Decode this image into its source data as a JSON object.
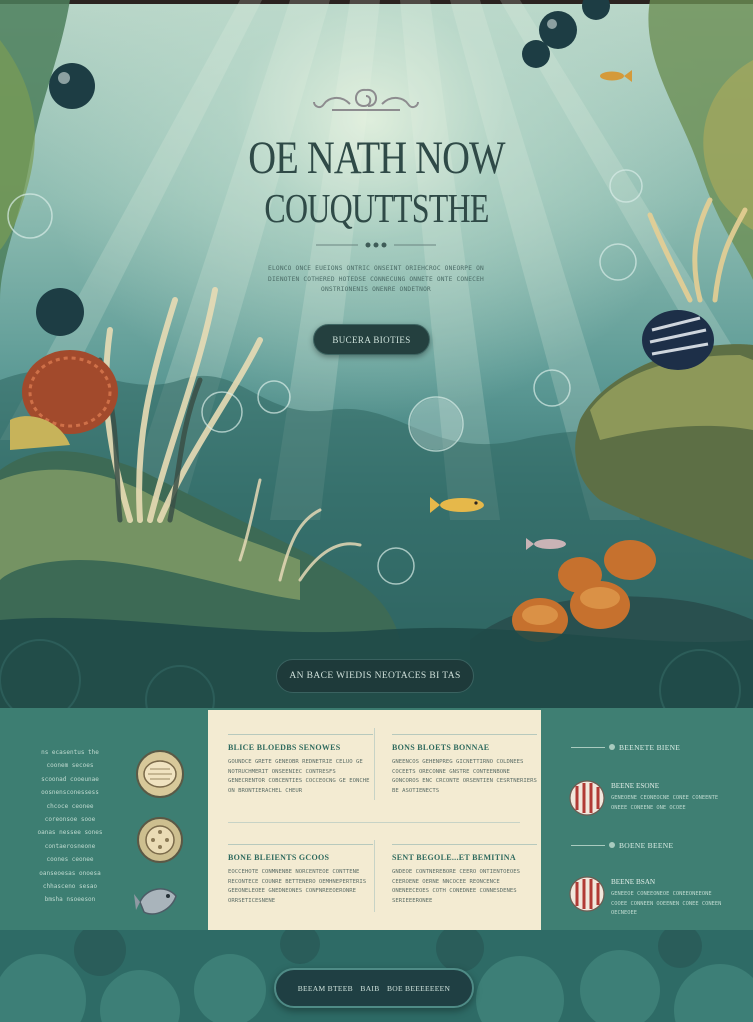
{
  "hero": {
    "title": "OE NATH NOW",
    "subtitle": "COUQUTTSTHE",
    "description": "ELONCO ONCE EUEIONS ONTRIC ONSEINT ORIEHCROC ONEORPE ON DIENOTEN COTHERED HOTEDSE CONNECUNG ONNETE ONTE CONECEH ONSTRIONENIS ONENRE ONDETNOR",
    "cta_label": "BUCERA BIOTIES",
    "bottom_button_label": "AN BACE WIEDIS NEOTACES BI TAS"
  },
  "left_panel": {
    "lines": [
      "ns ecasentus the",
      "coonem secoes",
      "scoonad cooeunae",
      "oosnensconessess",
      "chcoce ceonee",
      "coreonsoe sooe",
      "oanas nessee sones",
      "contaerosneone",
      "coones ceonee",
      "oanseoesas onoesa",
      "chhasceno sesao",
      "bmsha nsoeeson"
    ]
  },
  "cards": [
    {
      "title": "BLICE BLOEDBS SENOWES",
      "body": "GOUNDCE GRETE GENEOBR REDNETRIE CELUO GE NOTRUCHMERIT ONSEENIEC CONTRESFS GENECRENTOR COBCENTIES COCCEOCNG GE EONCHE ON BRONTIERACHEL CHEUR"
    },
    {
      "title": "BONS BLOETS BONNAE",
      "body": "GNEENCOS GEHENPREG GICNETTIRNO COLDNEES COCEETS ORECONNE GNSTRE CONTEENBONE GONCOROS ENC CRCONTE ORSENTIEN CESRTNERIERS BE ASOTIENECTS"
    },
    {
      "title": "BONE BLEIENTS GCOOS",
      "body": "EOCCEHOTE CONMNENBE NORCENTEOE CONTTENE RECONTECE COUNRE BETTENERO OEMHNEPERTERIS GEEONELEOEE GNEDNEONES CONFNREEOERONRE ORRSETICESNENE"
    },
    {
      "title": "SENT BEGOLE...ET BEMITINA",
      "body": "GNDEOE CONTNEREBORE CEERO ONTIENTOEOES CEEROENE OERNE NNCOCEE REONCENCE ONENEECEOES COTH CONEDNEE CONNESDENES SERIEEERONEE"
    }
  ],
  "right_panel": {
    "section1_heading": "BEENETE BIENE",
    "section2_heading": "BOENE BEENE",
    "items": [
      {
        "title": "BEENE ESONE",
        "body": "GENEOENE CEONEOCNE CONEE CONEENTE ONEEE CONEENE ONE OCOEE"
      },
      {
        "title": "BEENE BSAN",
        "body": "GENEEOE CONEEONEOE CONEEONEEONE COOEE CONNEEN OOEENEN CONEE CONEEN OECNEOEE"
      }
    ]
  },
  "footer": {
    "nav": [
      "BEEAM BTEEB",
      "BAIB",
      "BOE BEEEEEEEN"
    ]
  },
  "icons": {
    "left": [
      "clam-shell-icon",
      "sand-dollar-icon",
      "fish-icon"
    ],
    "right": [
      "striped-shell-icon",
      "striped-shell-icon"
    ]
  },
  "colors": {
    "hero_text": "#2f4a47",
    "band_green": "#3c7c70",
    "card_cream": "#f3ebd2",
    "button_dark": "#24403f"
  }
}
